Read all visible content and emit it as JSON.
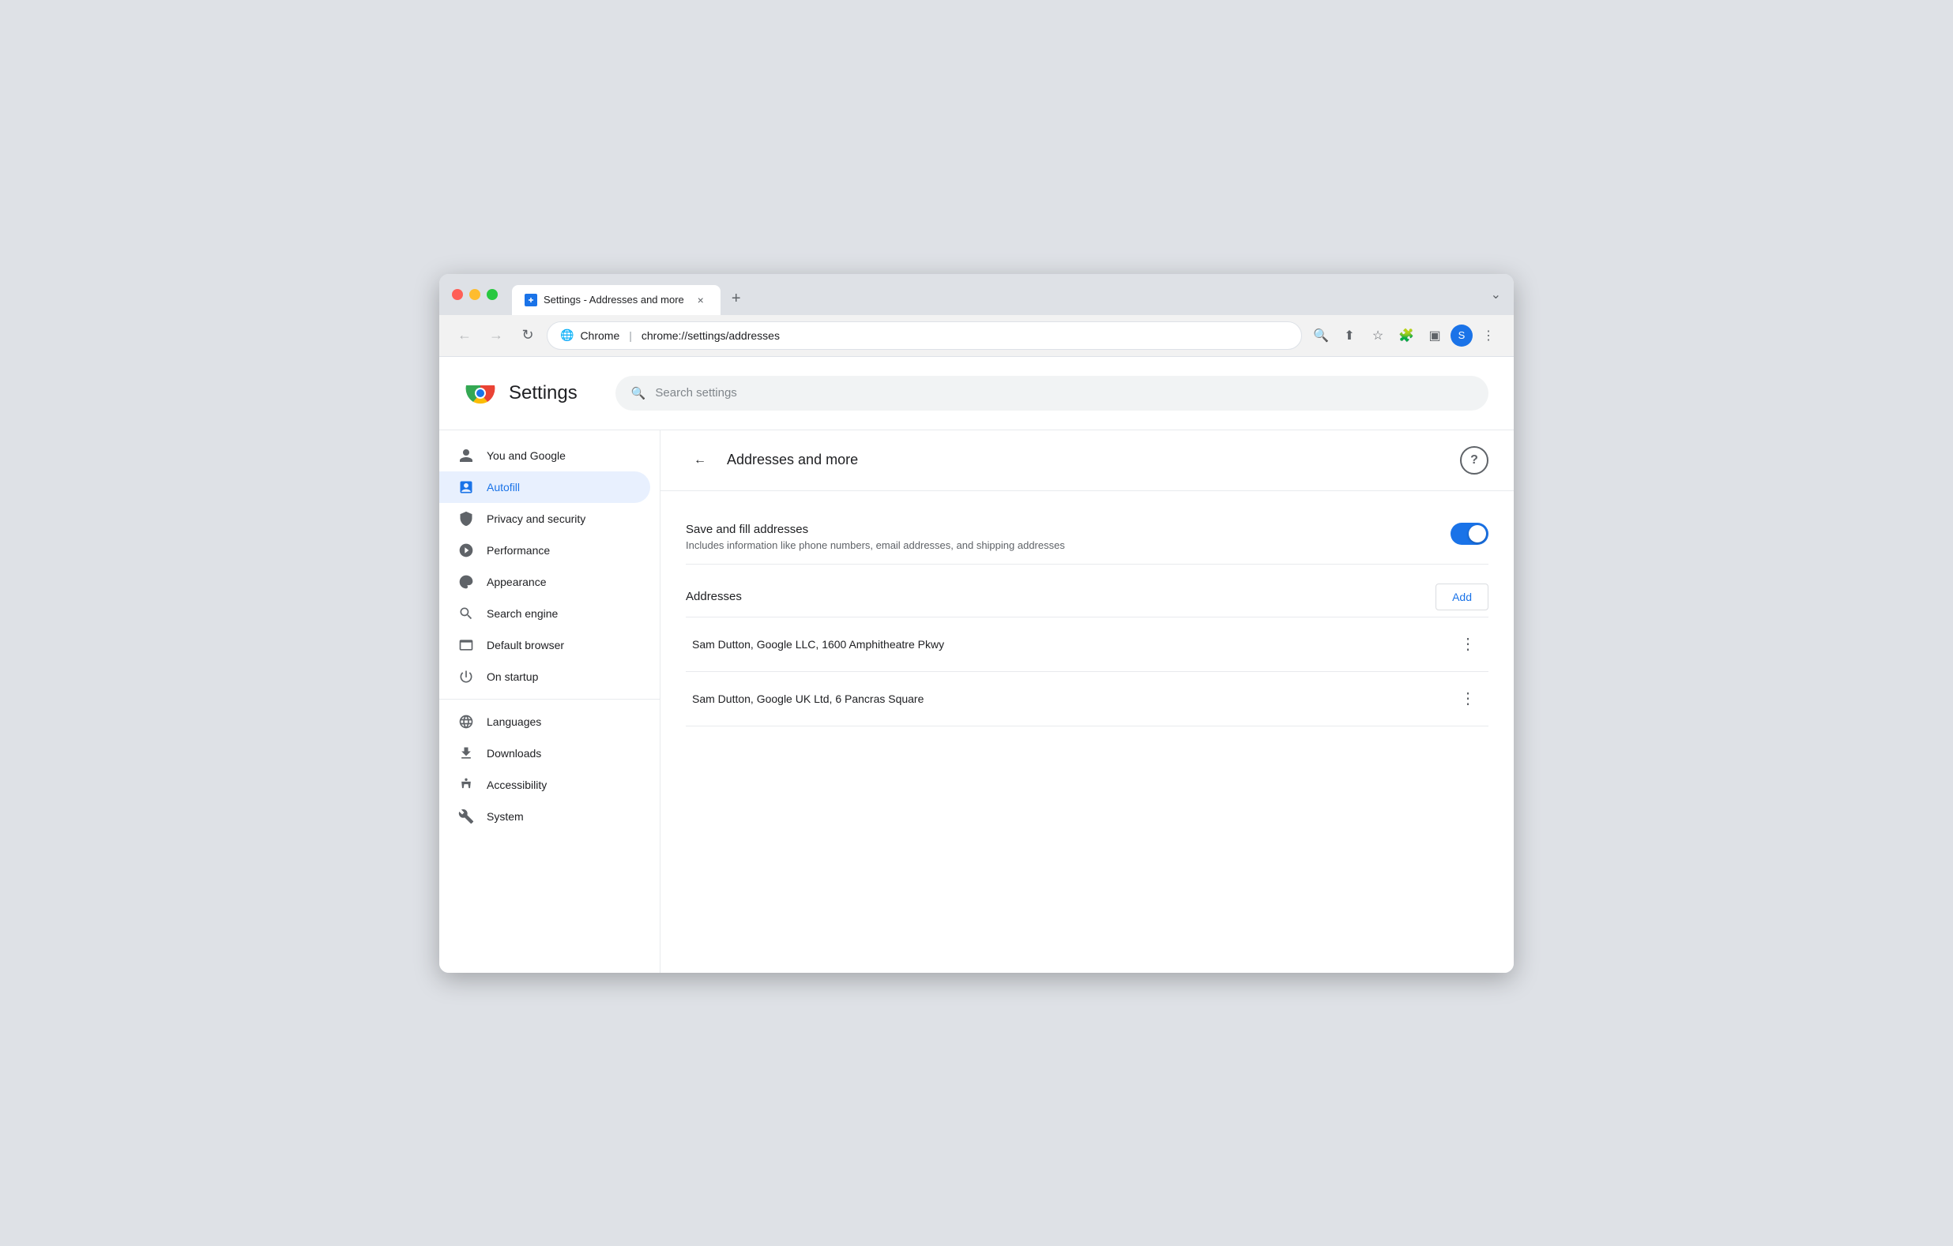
{
  "browser": {
    "tab": {
      "favicon_color": "#1a73e8",
      "title": "Settings - Addresses and more",
      "close_label": "×"
    },
    "new_tab_label": "+",
    "expand_label": "⌄",
    "nav": {
      "back_label": "←",
      "forward_label": "→",
      "refresh_label": "↻"
    },
    "omnibar": {
      "domain": "Chrome",
      "separator": "|",
      "url": "chrome://settings/addresses"
    },
    "toolbar_icons": {
      "zoom_label": "🔍",
      "share_label": "⬆",
      "bookmark_label": "☆",
      "extensions_label": "🧩",
      "sidebar_label": "▣",
      "menu_label": "⋮"
    },
    "avatar": {
      "label": "S",
      "color": "#1a73e8"
    }
  },
  "settings": {
    "logo_alt": "Chrome",
    "title": "Settings",
    "search_placeholder": "Search settings",
    "sidebar": {
      "items": [
        {
          "id": "you-and-google",
          "label": "You and Google",
          "icon": "person"
        },
        {
          "id": "autofill",
          "label": "Autofill",
          "icon": "autofill",
          "active": true
        },
        {
          "id": "privacy-security",
          "label": "Privacy and security",
          "icon": "shield"
        },
        {
          "id": "performance",
          "label": "Performance",
          "icon": "performance"
        },
        {
          "id": "appearance",
          "label": "Appearance",
          "icon": "appearance"
        },
        {
          "id": "search-engine",
          "label": "Search engine",
          "icon": "search"
        },
        {
          "id": "default-browser",
          "label": "Default browser",
          "icon": "browser"
        },
        {
          "id": "on-startup",
          "label": "On startup",
          "icon": "power"
        }
      ],
      "divider": true,
      "items2": [
        {
          "id": "languages",
          "label": "Languages",
          "icon": "globe"
        },
        {
          "id": "downloads",
          "label": "Downloads",
          "icon": "download"
        },
        {
          "id": "accessibility",
          "label": "Accessibility",
          "icon": "accessibility"
        },
        {
          "id": "system",
          "label": "System",
          "icon": "system"
        }
      ]
    },
    "main": {
      "back_label": "←",
      "section_title": "Addresses and more",
      "help_label": "?",
      "toggle": {
        "label": "Save and fill addresses",
        "description": "Includes information like phone numbers, email addresses, and shipping addresses",
        "enabled": true
      },
      "addresses": {
        "label": "Addresses",
        "add_button_label": "Add",
        "items": [
          {
            "text": "Sam Dutton, Google LLC, 1600 Amphitheatre Pkwy"
          },
          {
            "text": "Sam Dutton, Google UK Ltd, 6 Pancras Square"
          }
        ],
        "more_label": "⋮"
      }
    }
  }
}
